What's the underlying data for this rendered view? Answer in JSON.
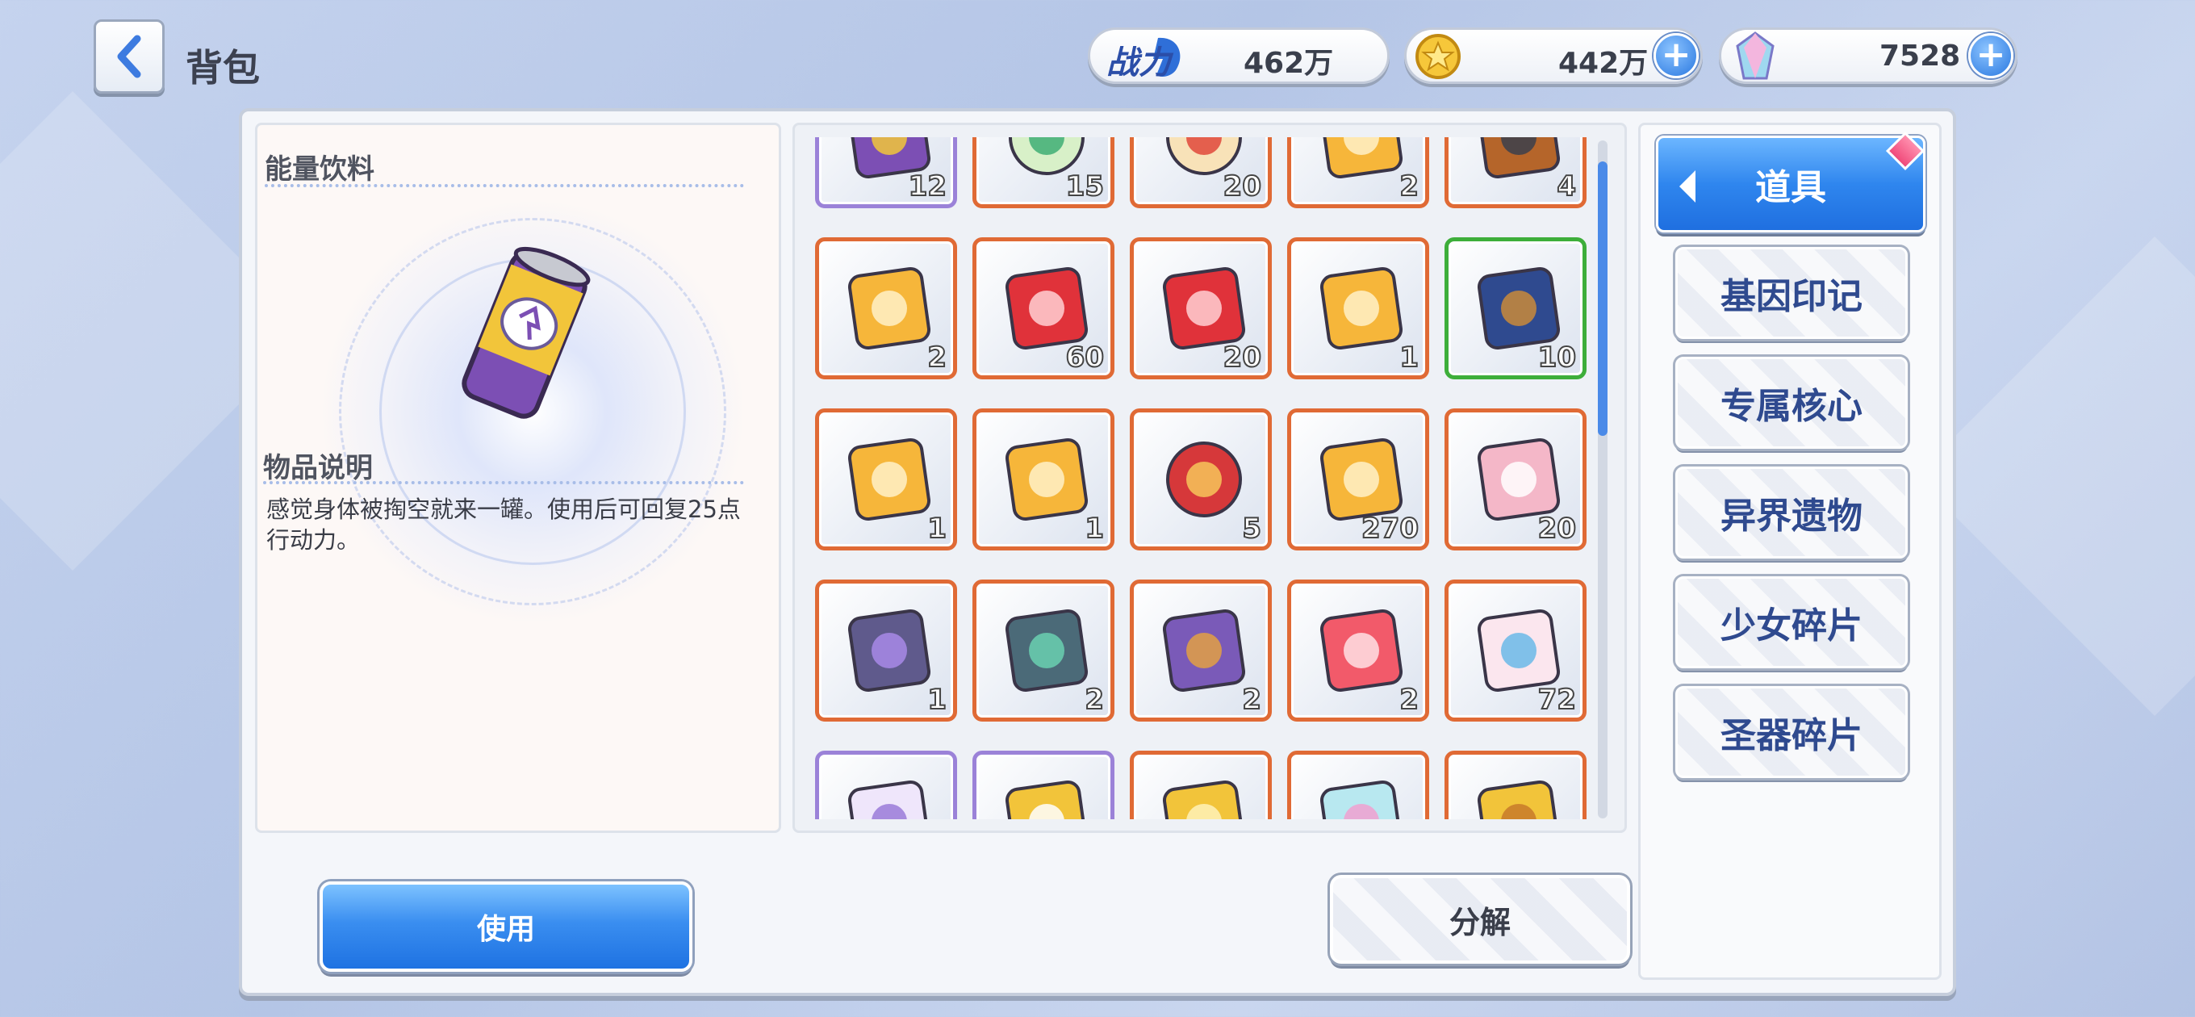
{
  "header": {
    "title": "背包",
    "power": {
      "label": "战力",
      "value": "462万"
    },
    "gold": {
      "value": "442万"
    },
    "gems": {
      "value": "7528"
    }
  },
  "detail": {
    "item_name": "能量饮料",
    "desc_title": "物品说明",
    "desc_text": "感觉身体被掏空就来一罐。使用后可回复25点行动力。",
    "use_label": "使用"
  },
  "grid": {
    "items": [
      {
        "icon": "energy-drink-icon",
        "qty": "12",
        "frame": "purple"
      },
      {
        "icon": "green-molecule-orb-icon",
        "qty": "15",
        "frame": "orange"
      },
      {
        "icon": "red-molecule-orb-icon",
        "qty": "20",
        "frame": "orange"
      },
      {
        "icon": "gold-crystal-cube-icon",
        "qty": "2",
        "frame": "orange"
      },
      {
        "icon": "treasure-chest-icon",
        "qty": "4",
        "frame": "orange"
      },
      {
        "icon": "gold-crystal-cube-icon",
        "qty": "2",
        "frame": "orange"
      },
      {
        "icon": "red-crystal-cube-icon",
        "qty": "60",
        "frame": "orange"
      },
      {
        "icon": "red-crystal-cube-icon",
        "qty": "20",
        "frame": "orange"
      },
      {
        "icon": "gold-crystal-cube-icon",
        "qty": "1",
        "frame": "orange"
      },
      {
        "icon": "chip-chest-icon",
        "qty": "10",
        "frame": "green"
      },
      {
        "icon": "gold-crystal-cube-icon",
        "qty": "1",
        "frame": "orange"
      },
      {
        "icon": "gold-crystal-cube-icon",
        "qty": "1",
        "frame": "orange"
      },
      {
        "icon": "red-lucky-bag-icon",
        "qty": "5",
        "frame": "orange"
      },
      {
        "icon": "gold-crystal-cube-icon",
        "qty": "270",
        "frame": "orange"
      },
      {
        "icon": "pink-gift-box-icon",
        "qty": "20",
        "frame": "orange"
      },
      {
        "icon": "purple-gem-box-icon",
        "qty": "1",
        "frame": "orange"
      },
      {
        "icon": "green-gem-box-icon",
        "qty": "2",
        "frame": "orange"
      },
      {
        "icon": "smile-gift-basket-icon",
        "qty": "2",
        "frame": "orange"
      },
      {
        "icon": "red-ticket-icon",
        "qty": "2",
        "frame": "orange"
      },
      {
        "icon": "outfit-ticket-icon",
        "qty": "72",
        "frame": "orange"
      },
      {
        "icon": "smile-ticket-icon",
        "qty": "",
        "frame": "purple"
      },
      {
        "icon": "dna-card-icon",
        "qty": "",
        "frame": "purple"
      },
      {
        "icon": "gold-card-icon",
        "qty": "",
        "frame": "orange"
      },
      {
        "icon": "rainbow-ticket-icon",
        "qty": "",
        "frame": "orange"
      },
      {
        "icon": "sword-card-icon",
        "qty": "",
        "frame": "orange"
      }
    ]
  },
  "decompose_label": "分解",
  "tabs": {
    "active": "道具",
    "items": [
      "基因印记",
      "专属核心",
      "异界遗物",
      "少女碎片",
      "圣器碎片"
    ]
  },
  "colors": {
    "accent": "#2f86ee",
    "frame_orange": "#e06a35",
    "frame_purple": "#9b82d8",
    "frame_green": "#3dae3a"
  }
}
